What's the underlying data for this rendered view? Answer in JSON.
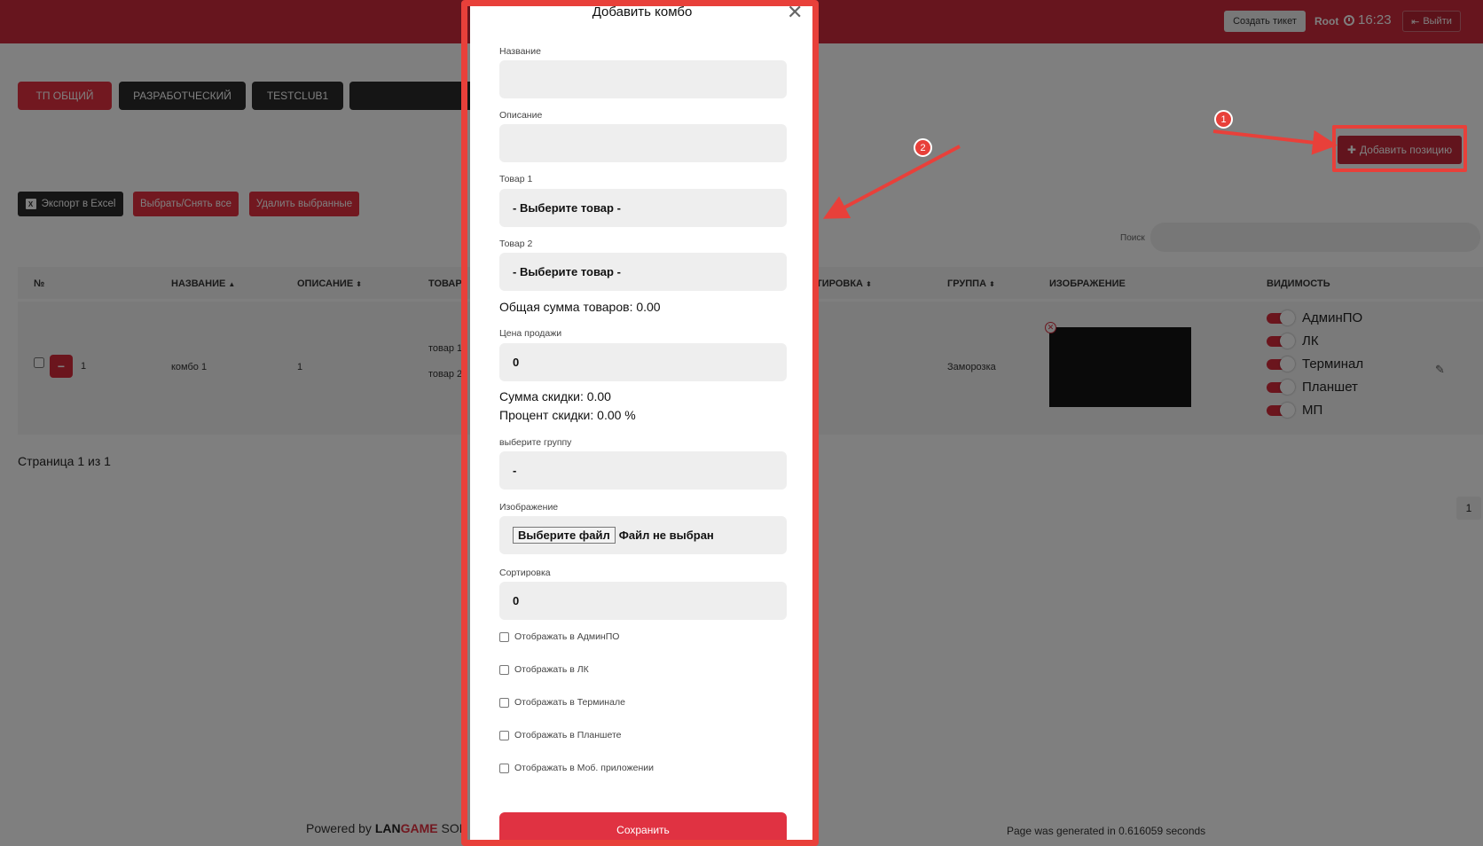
{
  "header": {
    "ticket_label": "Создать тикет",
    "user": "Root",
    "time": "16:23",
    "logout_label": "Выйти"
  },
  "clubs": [
    "ТП ОБЩИЙ",
    "РАЗРАБОТЧЕСКИЙ",
    "TESTCLUB1"
  ],
  "toolbar": {
    "add_position": "Добавить позицию",
    "export_excel": "Экспорт в Excel",
    "select_all": "Выбрать/Снять все",
    "delete_selected": "Удалить выбранные",
    "search_label": "Поиск"
  },
  "table": {
    "headers": [
      "№",
      "НАЗВАНИЕ",
      "ОПИСАНИЕ",
      "ТОВАР",
      "ТИРОВКА",
      "ГРУППА",
      "ИЗОБРАЖЕНИЕ",
      "ВИДИМОСТЬ"
    ],
    "row": {
      "num": "1",
      "name": "комбо 1",
      "description": "1",
      "goods1": "товар 1",
      "goods2": "товар 2",
      "group": "Заморозка",
      "visibility": [
        "АдминПО",
        "ЛК",
        "Терминал",
        "Планшет",
        "МП"
      ]
    }
  },
  "pagination": {
    "info": "Страница 1 из 1",
    "current": "1"
  },
  "footer": {
    "powered": "Powered by",
    "brand_part1": "LAN",
    "brand_part2": "GAME",
    "brand_part3": " SOF",
    "generated": "Page was generated in 0.616059 seconds"
  },
  "modal": {
    "title": "Добавить комбо",
    "name_label": "Название",
    "desc_label": "Описание",
    "goods1_label": "Товар 1",
    "goods1_value": "- Выберите товар -",
    "goods2_label": "Товар 2",
    "goods2_value": "- Выберите товар -",
    "total": "Общая сумма товаров: 0.00",
    "price_label": "Цена продажи",
    "price_value": "0",
    "discount_sum": "Сумма скидки: 0.00",
    "discount_pct": "Процент скидки: 0.00 %",
    "group_label": "выберите группу",
    "group_value": "-",
    "image_label": "Изображение",
    "file_button": "Выберите файл",
    "file_status": "Файл не выбран",
    "sort_label": "Сортировка",
    "sort_value": "0",
    "checkboxes": [
      "Отображать в АдминПО",
      "Отображать в ЛК",
      "Отображать в Терминале",
      "Отображать в Планшете",
      "Отображать в Моб. приложении"
    ],
    "save": "Сохранить"
  },
  "annotations": [
    "1",
    "2"
  ],
  "colors": {
    "brand_red": "#cf2a3c",
    "annotation_red": "#e8403a"
  }
}
